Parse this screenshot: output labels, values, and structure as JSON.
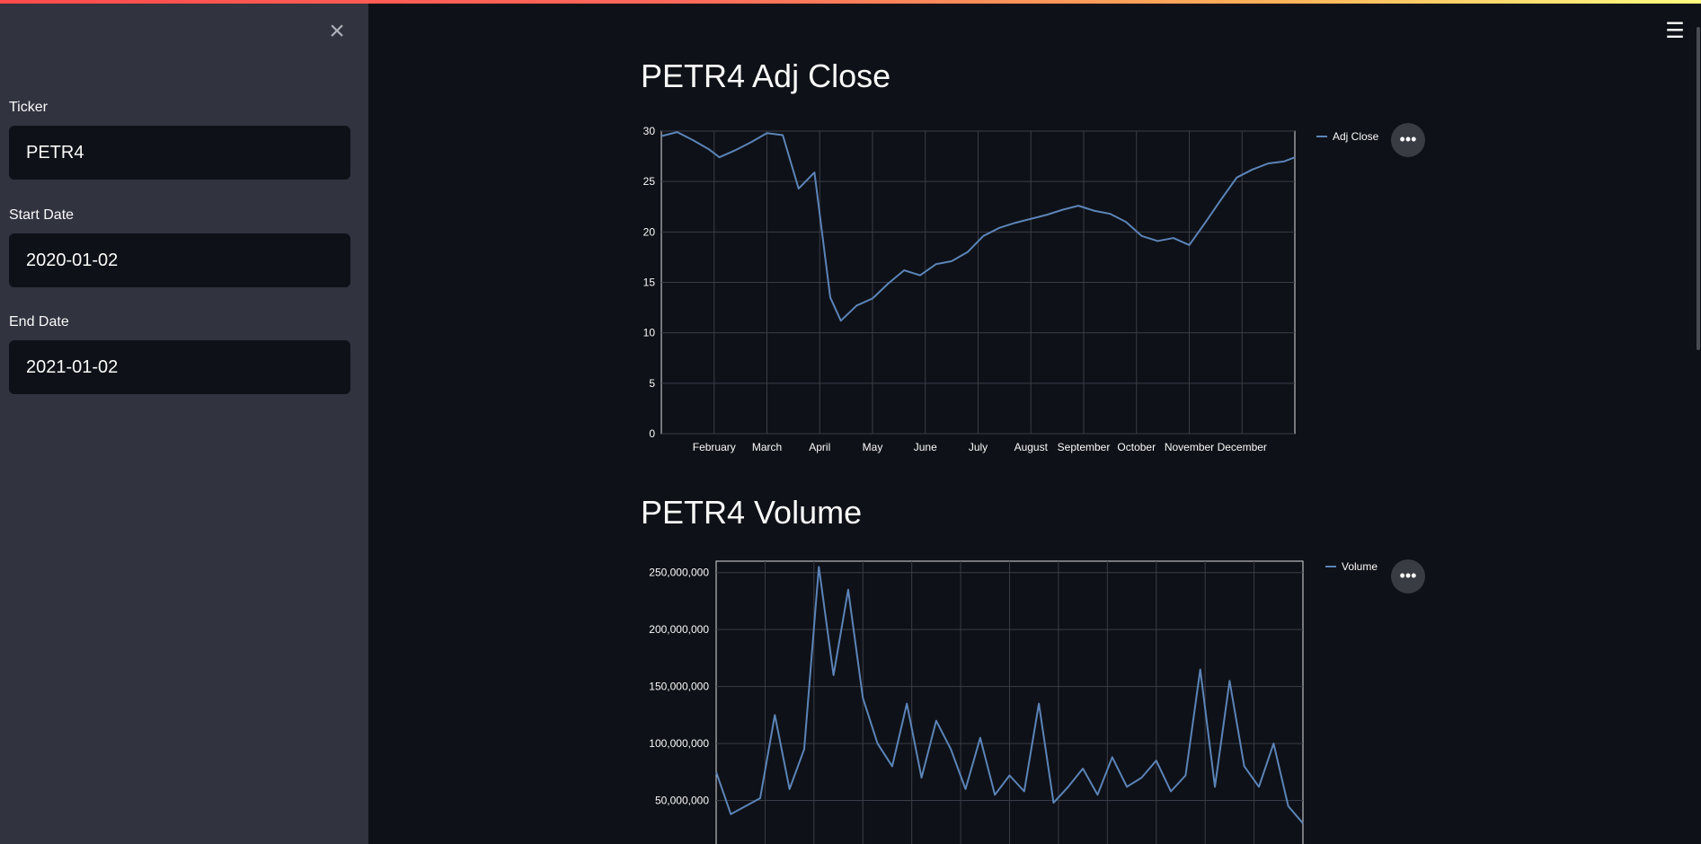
{
  "sidebar": {
    "close_icon": "×",
    "ticker": {
      "label": "Ticker",
      "value": "PETR4"
    },
    "start_date": {
      "label": "Start Date",
      "value": "2020-01-02"
    },
    "end_date": {
      "label": "End Date",
      "value": "2021-01-02"
    }
  },
  "header": {
    "menu_icon": "☰"
  },
  "more_icon": "•••",
  "colors": {
    "line": "#5b84b8",
    "background": "#0e1117",
    "sidebar": "#31333f",
    "accent": "#ff4b4b"
  },
  "chart_data": [
    {
      "type": "line",
      "title": "PETR4 Adj Close",
      "legend": [
        "Adj Close"
      ],
      "legend_position": "top-right",
      "xlabel": "",
      "ylabel": "",
      "x_ticks": [
        "February",
        "March",
        "April",
        "May",
        "June",
        "July",
        "August",
        "September",
        "October",
        "November",
        "December"
      ],
      "y_ticks": [
        0,
        5,
        10,
        15,
        20,
        25,
        30
      ],
      "ylim": [
        0,
        30
      ],
      "grid": true,
      "x_months": [
        0,
        0.3,
        0.6,
        0.9,
        1.1,
        1.4,
        1.7,
        2.0,
        2.3,
        2.6,
        2.9,
        3.2,
        3.4,
        3.7,
        4.0,
        4.3,
        4.6,
        4.9,
        5.2,
        5.5,
        5.8,
        6.1,
        6.4,
        6.7,
        7.0,
        7.3,
        7.6,
        7.9,
        8.2,
        8.5,
        8.8,
        9.1,
        9.4,
        9.7,
        10.0,
        10.3,
        10.6,
        10.9,
        11.2,
        11.5,
        11.8,
        12.0
      ],
      "series": [
        {
          "name": "Adj Close",
          "values": [
            29.5,
            29.9,
            29.1,
            28.2,
            27.4,
            28.1,
            28.9,
            29.8,
            29.6,
            24.3,
            25.9,
            13.5,
            11.2,
            12.7,
            13.4,
            14.9,
            16.2,
            15.7,
            16.8,
            17.1,
            18.0,
            19.6,
            20.4,
            20.9,
            21.3,
            21.7,
            22.2,
            22.6,
            22.1,
            21.8,
            21.0,
            19.6,
            19.1,
            19.4,
            18.7,
            20.9,
            23.2,
            25.4,
            26.2,
            26.8,
            27.0,
            27.4
          ]
        }
      ]
    },
    {
      "type": "line",
      "title": "PETR4 Volume",
      "legend": [
        "Volume"
      ],
      "legend_position": "top-right",
      "xlabel": "",
      "ylabel": "",
      "y_ticks": [
        "250,000,000",
        "200,000,000",
        "150,000,000",
        "100,000,000",
        "50,000,000"
      ],
      "y_tick_values": [
        250000000,
        200000000,
        150000000,
        100000000,
        50000000
      ],
      "ylim": [
        0,
        260000000
      ],
      "grid": true,
      "x_months": [
        0,
        0.3,
        0.6,
        0.9,
        1.2,
        1.5,
        1.8,
        2.1,
        2.4,
        2.7,
        3.0,
        3.3,
        3.6,
        3.9,
        4.2,
        4.5,
        4.8,
        5.1,
        5.4,
        5.7,
        6.0,
        6.3,
        6.6,
        6.9,
        7.2,
        7.5,
        7.8,
        8.1,
        8.4,
        8.7,
        9.0,
        9.3,
        9.6,
        9.9,
        10.2,
        10.5,
        10.8,
        11.1,
        11.4,
        11.7,
        12.0
      ],
      "series": [
        {
          "name": "Volume",
          "values": [
            75000000,
            38000000,
            45000000,
            52000000,
            125000000,
            60000000,
            95000000,
            255000000,
            160000000,
            235000000,
            140000000,
            100000000,
            80000000,
            135000000,
            70000000,
            120000000,
            95000000,
            60000000,
            105000000,
            55000000,
            72000000,
            58000000,
            135000000,
            48000000,
            62000000,
            78000000,
            55000000,
            88000000,
            62000000,
            70000000,
            85000000,
            58000000,
            72000000,
            165000000,
            62000000,
            155000000,
            80000000,
            62000000,
            100000000,
            45000000,
            30000000
          ]
        }
      ]
    }
  ]
}
